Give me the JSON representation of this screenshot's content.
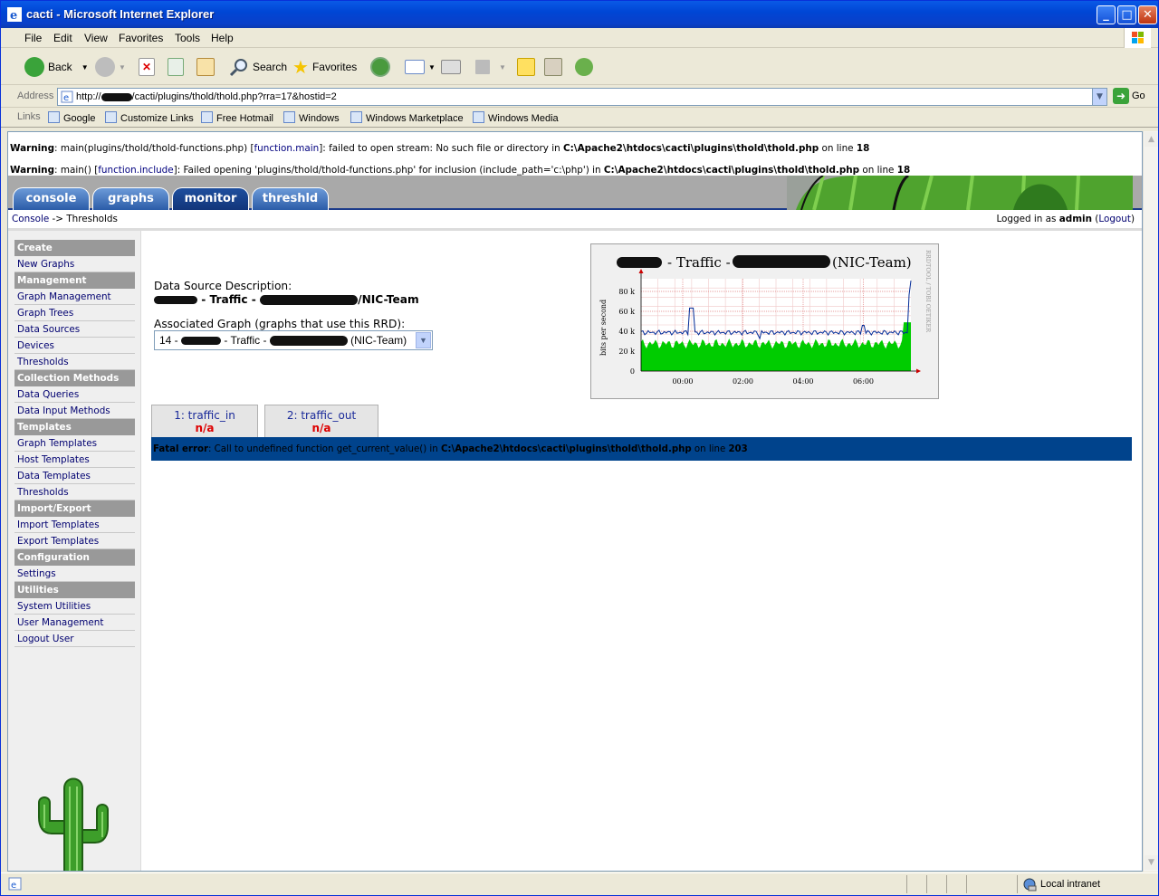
{
  "window": {
    "title": "cacti - Microsoft Internet Explorer",
    "min": "_",
    "max": "□",
    "close": "✕"
  },
  "menu": [
    "File",
    "Edit",
    "View",
    "Favorites",
    "Tools",
    "Help"
  ],
  "toolbar": {
    "back": "Back",
    "search": "Search",
    "favorites": "Favorites"
  },
  "address": {
    "label": "Address",
    "url_prefix": "http://",
    "url_suffix": "/cacti/plugins/thold/thold.php?rra=17&hostid=2",
    "go": "Go"
  },
  "links": {
    "label": "Links",
    "items": [
      "Google",
      "Customize Links",
      "Free Hotmail",
      "Windows",
      "Windows Marketplace",
      "Windows Media"
    ]
  },
  "warnings": [
    {
      "prefix": "Warning",
      "text1": ": main(plugins/thold/thold-functions.php) [",
      "link": "function.main",
      "text2": "]: failed to open stream: No such file or directory in ",
      "path": "C:\\Apache2\\htdocs\\cacti\\plugins\\thold\\thold.php",
      "text3": " on line ",
      "line": "18"
    },
    {
      "prefix": "Warning",
      "text1": ": main() [",
      "link": "function.include",
      "text2": "]: Failed opening 'plugins/thold/thold-functions.php' for inclusion (include_path='c:\\php') in ",
      "path": "C:\\Apache2\\htdocs\\cacti\\plugins\\thold\\thold.php",
      "text3": " on line ",
      "line": "18"
    }
  ],
  "nav_tabs": [
    "console",
    "graphs",
    "monitor",
    "threshld"
  ],
  "breadcrumb": {
    "root": "Console",
    "arrow": " -> ",
    "current": "Thresholds"
  },
  "login": {
    "prefix": "Logged in as ",
    "user": "admin",
    "logout": "Logout"
  },
  "sidebar": [
    {
      "type": "head",
      "label": "Create"
    },
    {
      "type": "item",
      "label": "New Graphs"
    },
    {
      "type": "head",
      "label": "Management"
    },
    {
      "type": "item",
      "label": "Graph Management"
    },
    {
      "type": "item",
      "label": "Graph Trees"
    },
    {
      "type": "item",
      "label": "Data Sources"
    },
    {
      "type": "item",
      "label": "Devices"
    },
    {
      "type": "item",
      "label": "Thresholds"
    },
    {
      "type": "head",
      "label": "Collection Methods"
    },
    {
      "type": "item",
      "label": "Data Queries"
    },
    {
      "type": "item",
      "label": "Data Input Methods"
    },
    {
      "type": "head",
      "label": "Templates"
    },
    {
      "type": "item",
      "label": "Graph Templates"
    },
    {
      "type": "item",
      "label": "Host Templates"
    },
    {
      "type": "item",
      "label": "Data Templates"
    },
    {
      "type": "item",
      "label": "Thresholds"
    },
    {
      "type": "head",
      "label": "Import/Export"
    },
    {
      "type": "item",
      "label": "Import Templates"
    },
    {
      "type": "item",
      "label": "Export Templates"
    },
    {
      "type": "head",
      "label": "Configuration"
    },
    {
      "type": "item",
      "label": "Settings"
    },
    {
      "type": "head",
      "label": "Utilities"
    },
    {
      "type": "item",
      "label": "System Utilities"
    },
    {
      "type": "item",
      "label": "User Management"
    },
    {
      "type": "item",
      "label": "Logout User"
    }
  ],
  "main": {
    "ds_label": "Data Source Description:",
    "ds_part1": " - Traffic - ",
    "ds_part2": "/NIC-Team",
    "assoc_label": "Associated Graph (graphs that use this RRD):",
    "assoc_prefix": "14 - ",
    "assoc_mid": " - Traffic - ",
    "assoc_suffix": " (NIC-Team)",
    "tabs": [
      {
        "name": "1: traffic_in",
        "value": "n/a"
      },
      {
        "name": "2: traffic_out",
        "value": "n/a"
      }
    ],
    "fatal": {
      "prefix": "Fatal error",
      "text": ": Call to undefined function get_current_value() in ",
      "path": "C:\\Apache2\\htdocs\\cacti\\plugins\\thold\\thold.php",
      "text2": " on line ",
      "line": "203"
    }
  },
  "graph": {
    "title_mid": " - Traffic - ",
    "title_suffix": "(NIC-Team)",
    "ylabel": "bits per second",
    "side_label": "RRDTOOL / TOBI OETIKER",
    "yticks": [
      "0",
      "20 k",
      "40 k",
      "60 k",
      "80 k"
    ],
    "xticks": [
      "00:00",
      "02:00",
      "04:00",
      "06:00"
    ],
    "in_color": "#00cc00",
    "out_color": "#002a97"
  },
  "status": {
    "zone": "Local intranet"
  }
}
